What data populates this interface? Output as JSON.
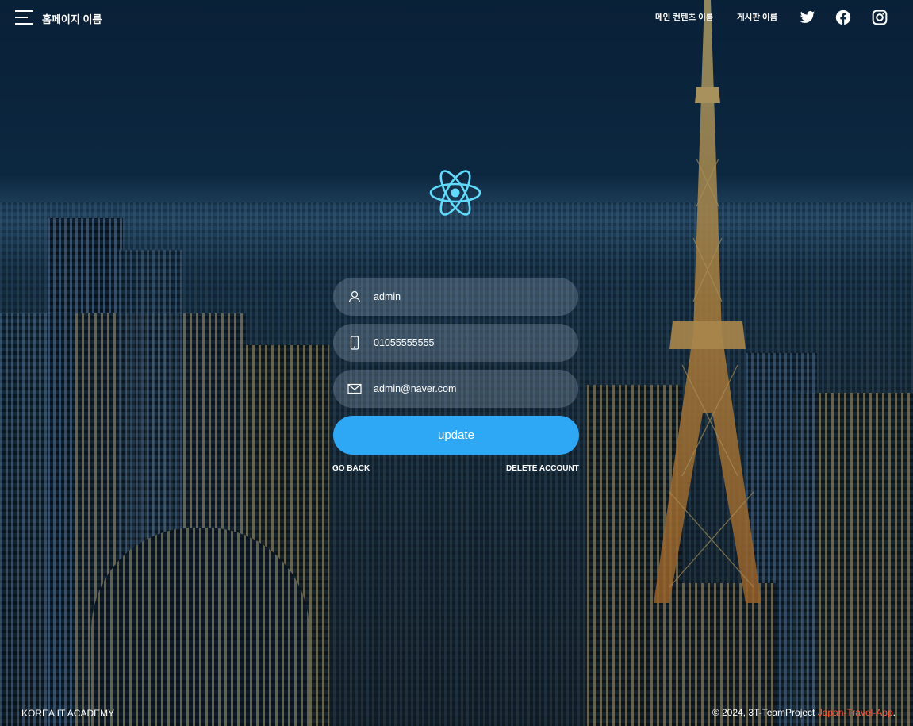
{
  "header": {
    "site_title": "홈페이지 이름",
    "nav": [
      {
        "label": "메인 컨텐츠 이름"
      },
      {
        "label": "게시판 이름"
      }
    ],
    "social_icons": [
      "twitter-icon",
      "facebook-icon",
      "instagram-icon"
    ]
  },
  "form": {
    "logo_icon": "react-atom-logo",
    "username": {
      "value": "admin",
      "icon": "user-icon"
    },
    "phone": {
      "value": "01055555555",
      "icon": "phone-icon"
    },
    "email": {
      "value": "admin@naver.com",
      "icon": "mail-icon"
    },
    "update_label": "update",
    "go_back_label": "GO BACK",
    "delete_account_label": "DELETE ACCOUNT"
  },
  "footer": {
    "left_text": "KOREA IT ACADEMY",
    "copyright_prefix": "© 2024, 3T-TeamProject ",
    "project_name": "Japan-Travel-App",
    "suffix": "."
  },
  "colors": {
    "accent_button": "#2ea7f5",
    "react_logo": "#61dafb",
    "footer_accent": "#ff5a36"
  }
}
